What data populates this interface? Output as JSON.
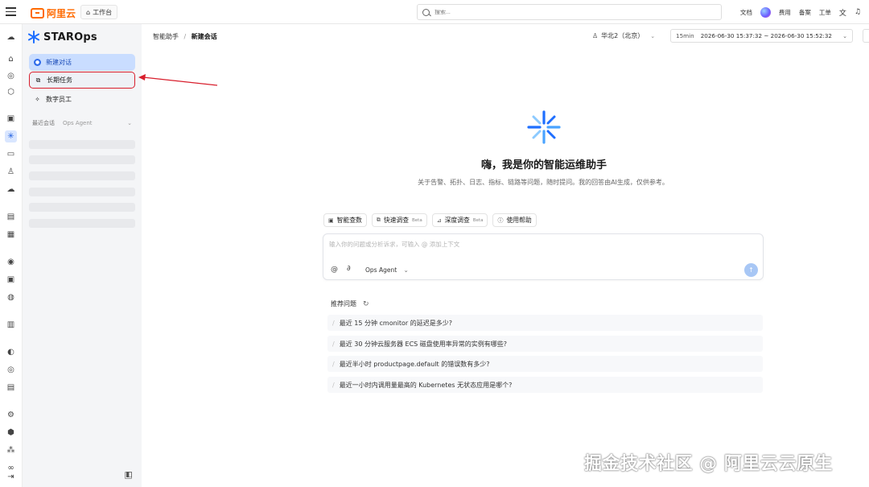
{
  "topbar": {
    "brand": "阿里云",
    "workbench": "工作台",
    "search_placeholder": "搜索...",
    "links": [
      "文档",
      "费用",
      "备案",
      "工单"
    ]
  },
  "sidebar": {
    "product": "STAROps",
    "items": [
      {
        "label": "新建对话",
        "icon": "chat-icon"
      },
      {
        "label": "长期任务",
        "icon": "task-icon"
      },
      {
        "label": "数字员工",
        "icon": "sparkle-icon"
      }
    ],
    "recent_label": "最近会话",
    "recent_agent": "Ops Agent"
  },
  "header": {
    "breadcrumb_root": "智能助手",
    "breadcrumb_sep": "/",
    "breadcrumb_current": "新建会话",
    "region": "华北2（北京）",
    "time_duration": "15min",
    "time_range": "2026-06-30 15:37:32 ~ 2026-06-30 15:52:32"
  },
  "hero": {
    "title": "嗨，我是你的智能运维助手",
    "subtitle": "关于告警、拓扑、日志、指标、链路等问题，随时提问。我的回答由AI生成，仅供参考。"
  },
  "modes": [
    {
      "label": "智能查数",
      "beta": ""
    },
    {
      "label": "快速调查",
      "beta": "Beta"
    },
    {
      "label": "深度调查",
      "beta": "Beta"
    },
    {
      "label": "使用帮助",
      "beta": ""
    }
  ],
  "composer": {
    "placeholder": "输入你的问题或分析诉求，可输入 @ 添加上下文",
    "agent": "Ops Agent"
  },
  "recommend": {
    "title": "推荐问题",
    "items": [
      "最近 15 分钟 cmonitor 的延迟是多少?",
      "最近 30 分钟云服务器 ECS 磁盘使用率异常的实例有哪些?",
      "最近半小时 productpage.default 的错误数有多少?",
      "最近一小时内调用量最高的 Kubernetes 无状态应用是哪个?"
    ]
  },
  "watermark": "掘金技术社区 @ 阿里云云原生",
  "colors": {
    "accent": "#2f6bea",
    "brand": "#ff6a00",
    "annotation": "#d81e2c"
  }
}
